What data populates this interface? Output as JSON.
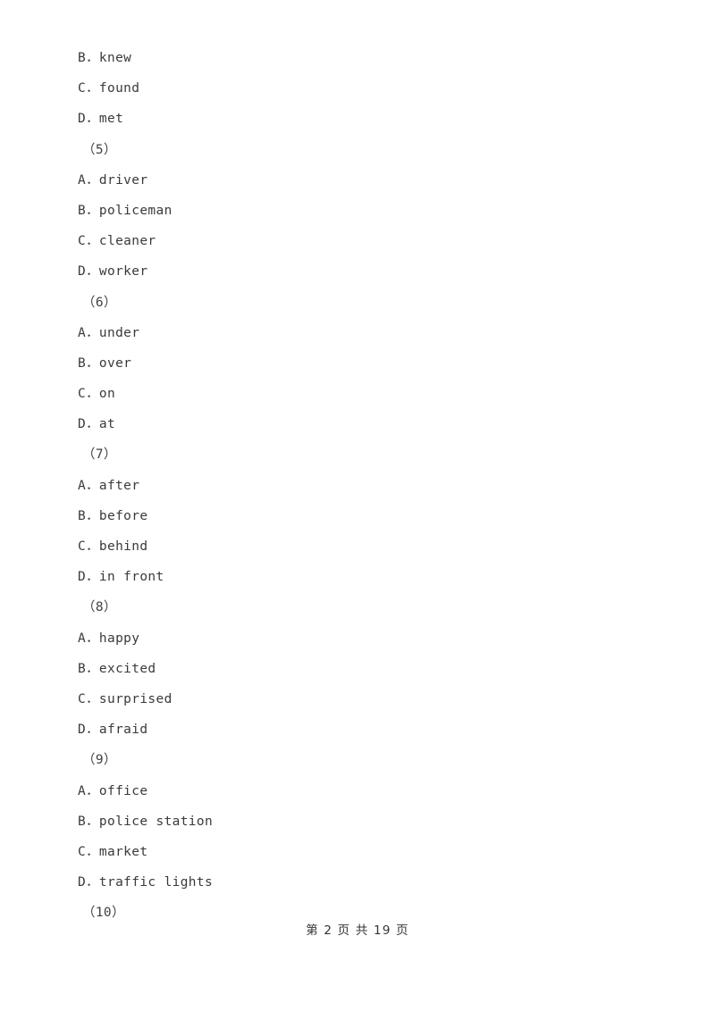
{
  "document": {
    "type": "scanned-exam-paper",
    "background_color": "#ffffff",
    "text_color": "#3a3a3a"
  },
  "body_lines": [
    {
      "kind": "option",
      "text": "B．knew"
    },
    {
      "kind": "option",
      "text": "C．found"
    },
    {
      "kind": "option",
      "text": "D．met"
    },
    {
      "kind": "question",
      "text": "（5）"
    },
    {
      "kind": "option",
      "text": "A．driver"
    },
    {
      "kind": "option",
      "text": "B．policeman"
    },
    {
      "kind": "option",
      "text": "C．cleaner"
    },
    {
      "kind": "option",
      "text": "D．worker"
    },
    {
      "kind": "question",
      "text": "（6）"
    },
    {
      "kind": "option",
      "text": "A．under"
    },
    {
      "kind": "option",
      "text": "B．over"
    },
    {
      "kind": "option",
      "text": "C．on"
    },
    {
      "kind": "option",
      "text": "D．at"
    },
    {
      "kind": "question",
      "text": "（7）"
    },
    {
      "kind": "option",
      "text": "A．after"
    },
    {
      "kind": "option",
      "text": "B．before"
    },
    {
      "kind": "option",
      "text": "C．behind"
    },
    {
      "kind": "option",
      "text": "D．in front"
    },
    {
      "kind": "question",
      "text": "（8）"
    },
    {
      "kind": "option",
      "text": "A．happy"
    },
    {
      "kind": "option",
      "text": "B．excited"
    },
    {
      "kind": "option",
      "text": "C．surprised"
    },
    {
      "kind": "option",
      "text": "D．afraid"
    },
    {
      "kind": "question",
      "text": "（9）"
    },
    {
      "kind": "option",
      "text": "A．office"
    },
    {
      "kind": "option",
      "text": "B．police station"
    },
    {
      "kind": "option",
      "text": "C．market"
    },
    {
      "kind": "option",
      "text": "D．traffic lights"
    },
    {
      "kind": "question",
      "text": "（10）"
    }
  ],
  "footer": {
    "text": "第 2 页 共 19 页",
    "current_page": "2",
    "total_pages": "19"
  }
}
